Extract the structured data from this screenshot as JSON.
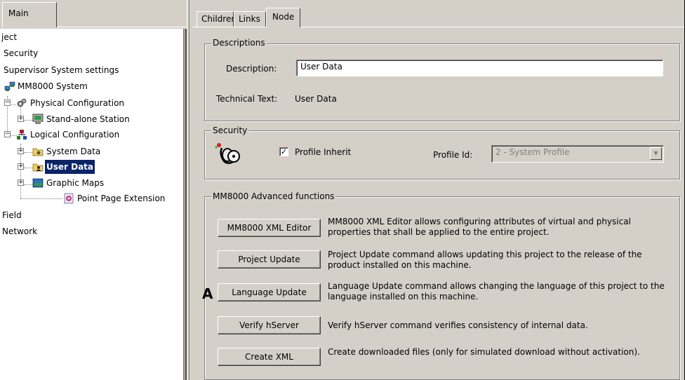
{
  "left_panel": {
    "tab_label": "Main",
    "tree": {
      "root": "ject",
      "security": "Security",
      "supervisor": "Supervisor System settings",
      "mm8000": "MM8000 System",
      "physical": "Physical Configuration",
      "standalone": "Stand-alone Station",
      "logical": "Logical Configuration",
      "system_data": "System Data",
      "user_data": "User Data",
      "graphic_maps": "Graphic Maps",
      "point_page": "Point Page Extension",
      "field": "Field",
      "network": "Network"
    }
  },
  "tabs": [
    "Children",
    "Links",
    "Node"
  ],
  "descriptions": {
    "legend": "Descriptions",
    "description_label": "Description:",
    "description_value": "User Data",
    "technical_label": "Technical Text:",
    "technical_value": "User Data"
  },
  "security": {
    "legend": "Security",
    "profile_inherit_label": "Profile Inherit",
    "profile_inherit_checked": true,
    "profile_id_label": "Profile Id:",
    "profile_id_value": "2 - System Profile"
  },
  "advanced": {
    "legend": "MM8000 Advanced functions",
    "items": [
      {
        "button": "MM8000 XML Editor",
        "description": "MM8000 XML Editor allows configuring attributes of virtual and physical properties that shall be applied to the entire project."
      },
      {
        "button": "Project Update",
        "description": "Project Update command allows updating this project to the release of the product installed on this machine."
      },
      {
        "button": "Language Update",
        "description": "Language Update command allows changing the language of this project to the language installed on this machine."
      },
      {
        "button": "Verify hServer",
        "description": "Verify hServer command verifies consistency of internal data."
      },
      {
        "button": "Create XML",
        "description": "Create downloaded files (only for simulated download without activation)."
      }
    ],
    "marker": "A"
  },
  "colors": {
    "selection": "#0a246a",
    "face": "#d4d0c8"
  }
}
